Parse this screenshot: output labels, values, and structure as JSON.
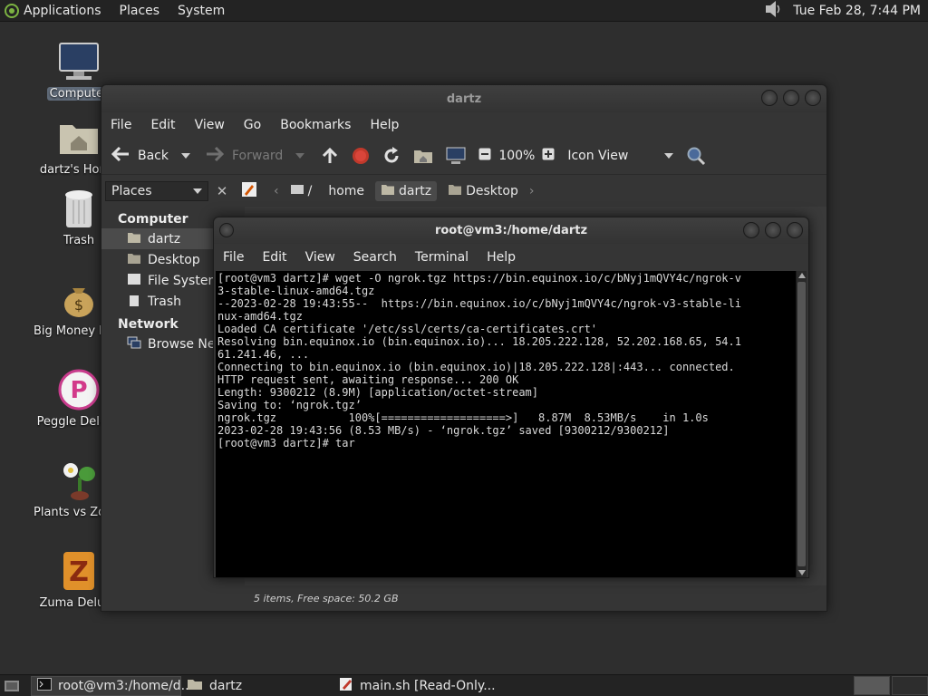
{
  "top_panel": {
    "menus": [
      "Applications",
      "Places",
      "System"
    ],
    "clock": "Tue Feb 28,  7:44 PM"
  },
  "desktop_icons": [
    {
      "label": "Computer",
      "icon": "monitor-icon"
    },
    {
      "label": "dartz's Home",
      "icon": "home-folder-icon"
    },
    {
      "label": "Trash",
      "icon": "trash-icon"
    },
    {
      "label": "Big Money Deluxe",
      "icon": "money-bag-icon"
    },
    {
      "label": "Peggle Deluxe",
      "icon": "peggle-icon"
    },
    {
      "label": "Plants vs Zombies",
      "icon": "plants-icon"
    },
    {
      "label": "Zuma Deluxe",
      "icon": "zuma-icon"
    }
  ],
  "file_manager": {
    "title": "dartz",
    "menu": [
      "File",
      "Edit",
      "View",
      "Go",
      "Bookmarks",
      "Help"
    ],
    "toolbar": {
      "back": "Back",
      "forward": "Forward",
      "zoom": "100%",
      "view_mode": "Icon View"
    },
    "places_combo": "Places",
    "breadcrumbs": [
      "/",
      "home",
      "dartz",
      "Desktop"
    ],
    "sidebar": {
      "computer_header": "Computer",
      "computer_items": [
        "dartz",
        "Desktop",
        "File System",
        "Trash"
      ],
      "network_header": "Network",
      "network_items": [
        "Browse Net..."
      ]
    },
    "status": "5 items, Free space: 50.2 GB"
  },
  "terminal": {
    "title": "root@vm3:/home/dartz",
    "menu": [
      "File",
      "Edit",
      "View",
      "Search",
      "Terminal",
      "Help"
    ],
    "lines": [
      "[root@vm3 dartz]# wget -O ngrok.tgz https://bin.equinox.io/c/bNyj1mQVY4c/ngrok-v",
      "3-stable-linux-amd64.tgz",
      "--2023-02-28 19:43:55--  https://bin.equinox.io/c/bNyj1mQVY4c/ngrok-v3-stable-li",
      "nux-amd64.tgz",
      "Loaded CA certificate '/etc/ssl/certs/ca-certificates.crt'",
      "Resolving bin.equinox.io (bin.equinox.io)... 18.205.222.128, 52.202.168.65, 54.1",
      "61.241.46, ...",
      "Connecting to bin.equinox.io (bin.equinox.io)|18.205.222.128|:443... connected.",
      "HTTP request sent, awaiting response... 200 OK",
      "Length: 9300212 (8.9M) [application/octet-stream]",
      "Saving to: ‘ngrok.tgz’",
      "",
      "ngrok.tgz           100%[===================>]   8.87M  8.53MB/s    in 1.0s",
      "",
      "2023-02-28 19:43:56 (8.53 MB/s) - ‘ngrok.tgz’ saved [9300212/9300212]",
      "",
      "[root@vm3 dartz]# tar"
    ]
  },
  "taskbar": {
    "tasks": [
      "root@vm3:/home/d...",
      "dartz",
      "main.sh [Read-Only..."
    ]
  }
}
